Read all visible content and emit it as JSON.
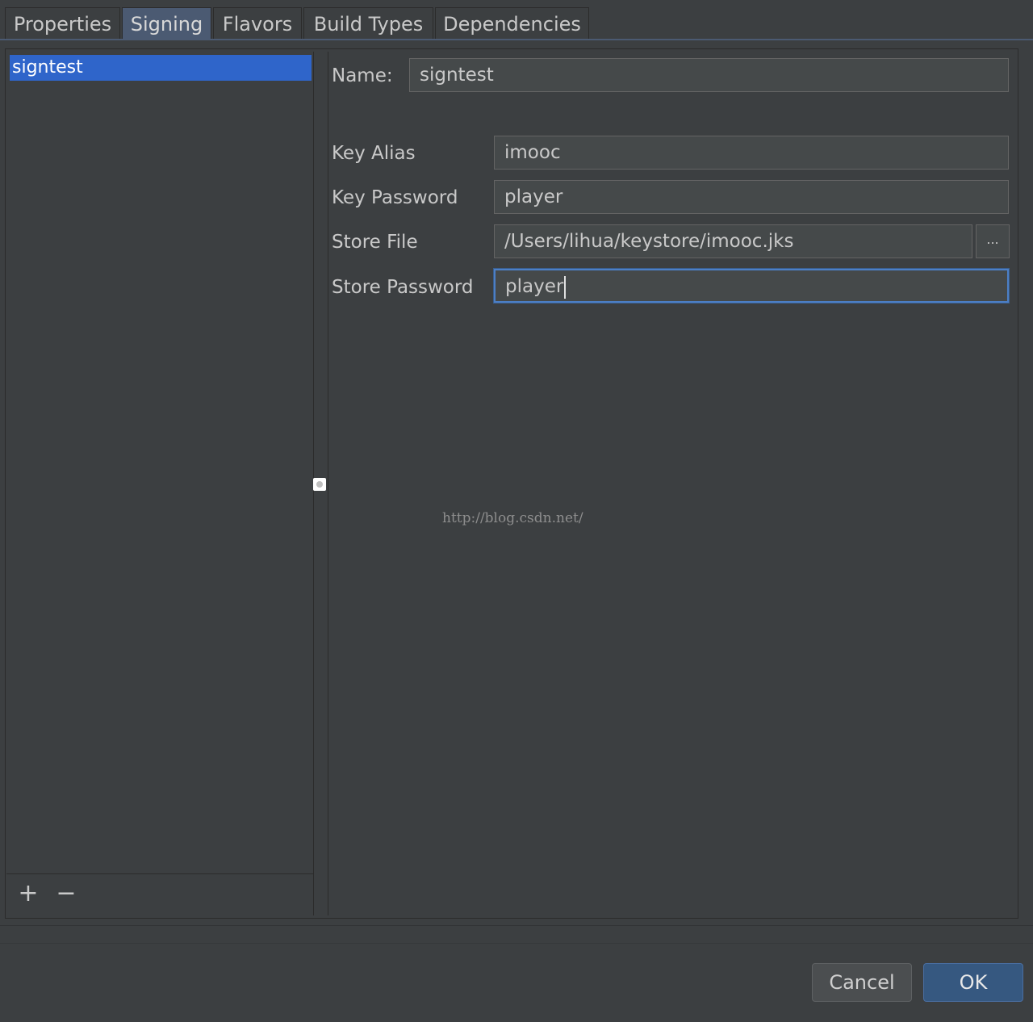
{
  "tabs": [
    "Properties",
    "Signing",
    "Flavors",
    "Build Types",
    "Dependencies"
  ],
  "active_tab": "Signing",
  "signing_configs": {
    "items": [
      "signtest"
    ],
    "selected": "signtest",
    "add_label": "+",
    "remove_label": "−"
  },
  "form": {
    "name_label": "Name:",
    "name_value": "signtest",
    "key_alias_label": "Key Alias",
    "key_alias_value": "imooc",
    "key_password_label": "Key Password",
    "key_password_value": "player",
    "store_file_label": "Store File",
    "store_file_value": "/Users/lihua/keystore/imooc.jks",
    "browse_label": "...",
    "store_password_label": "Store Password",
    "store_password_value": "player"
  },
  "watermark": "http://blog.csdn.net/",
  "buttons": {
    "cancel": "Cancel",
    "ok": "OK"
  },
  "colors": {
    "background": "#3c3f41",
    "selection": "#2f65ca",
    "active_tab": "#4b5a72",
    "focus": "#4c7fc6"
  }
}
